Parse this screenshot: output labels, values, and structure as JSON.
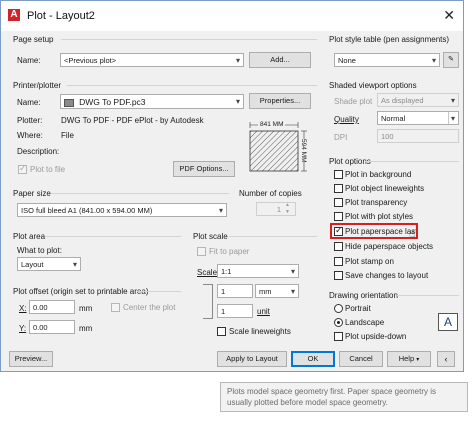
{
  "window": {
    "title": "Plot - Layout2",
    "logo_letter": "A",
    "close_glyph": "✕"
  },
  "page_setup": {
    "title": "Page setup",
    "name_label": "Name:",
    "name_value": "<Previous plot>",
    "add_button": "Add..."
  },
  "printer": {
    "title": "Printer/plotter",
    "name_label": "Name:",
    "name_value": "DWG To PDF.pc3",
    "properties_button": "Properties...",
    "plotter_label": "Plotter:",
    "plotter_value": "DWG To PDF - PDF ePlot - by Autodesk",
    "where_label": "Where:",
    "where_value": "File",
    "description_label": "Description:",
    "plot_to_file_label": "Plot to file",
    "pdf_options_button": "PDF Options...",
    "dim_width": "841  MM",
    "dim_height": "594  MM"
  },
  "paper_size": {
    "title": "Paper size",
    "value": "ISO full bleed A1 (841.00 x 594.00 MM)"
  },
  "copies": {
    "title": "Number of copies",
    "value": "1"
  },
  "plot_area": {
    "title": "Plot area",
    "what_label": "What to plot:",
    "what_value": "Layout"
  },
  "plot_scale": {
    "title": "Plot scale",
    "fit_label": "Fit to paper",
    "scale_label": "Scale:",
    "scale_value": "1:1",
    "value1": "1",
    "unit1": "mm",
    "value2": "1",
    "unit2_label": "unit",
    "scale_lineweights_label": "Scale lineweights"
  },
  "plot_offset": {
    "title": "Plot offset (origin set to printable area)",
    "x_label": "X:",
    "x_value": "0.00",
    "x_unit": "mm",
    "y_label": "Y:",
    "y_value": "0.00",
    "y_unit": "mm",
    "center_label": "Center the plot"
  },
  "style_table": {
    "title": "Plot style table (pen assignments)",
    "value": "None"
  },
  "shaded": {
    "title": "Shaded viewport options",
    "shade_label": "Shade plot",
    "shade_value": "As displayed",
    "quality_label": "Quality",
    "quality_value": "Normal",
    "dpi_label": "DPI",
    "dpi_value": "100"
  },
  "plot_options": {
    "title": "Plot options",
    "items": [
      {
        "label": "Plot in background",
        "checked": false
      },
      {
        "label": "Plot object lineweights",
        "checked": false
      },
      {
        "label": "Plot transparency",
        "checked": false
      },
      {
        "label": "Plot with plot styles",
        "checked": false
      },
      {
        "label": "Plot paperspace last",
        "checked": true
      },
      {
        "label": "Hide paperspace objects",
        "checked": false
      },
      {
        "label": "Plot stamp on",
        "checked": false
      },
      {
        "label": "Save changes to layout",
        "checked": false
      }
    ]
  },
  "orientation": {
    "title": "Drawing orientation",
    "portrait": "Portrait",
    "landscape": "Landscape",
    "upside_down": "Plot upside-down",
    "icon_letter": "A"
  },
  "footer": {
    "preview": "Preview...",
    "apply": "Apply to Layout",
    "ok": "OK",
    "cancel": "Cancel",
    "help": "Help"
  },
  "tooltip": {
    "text": "Plots model space geometry first. Paper space geometry is usually plotted before model space geometry."
  },
  "colors": {
    "highlight": "#d42020",
    "accent": "#0078d7",
    "logo": "#d1232a"
  }
}
